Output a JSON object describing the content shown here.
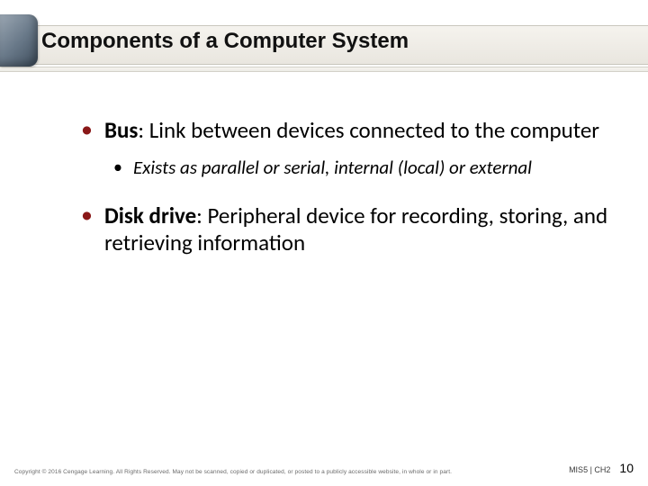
{
  "title": "Components of a Computer System",
  "bullets": {
    "b1": {
      "term": "Bus",
      "text": ": Link between devices connected to the computer"
    },
    "s1": {
      "text": "Exists as parallel or serial, internal (local) or external"
    },
    "b2": {
      "term": "Disk drive",
      "text": ": Peripheral device for recording, storing, and retrieving information"
    }
  },
  "footer": {
    "copyright": "Copyright © 2016 Cengage Learning. All Rights Reserved. May not be scanned, copied or duplicated, or posted to a publicly accessible website, in whole or in part.",
    "chapter": "MIS5 | CH2",
    "page": "10"
  },
  "colors": {
    "accent": "#8a1818"
  }
}
